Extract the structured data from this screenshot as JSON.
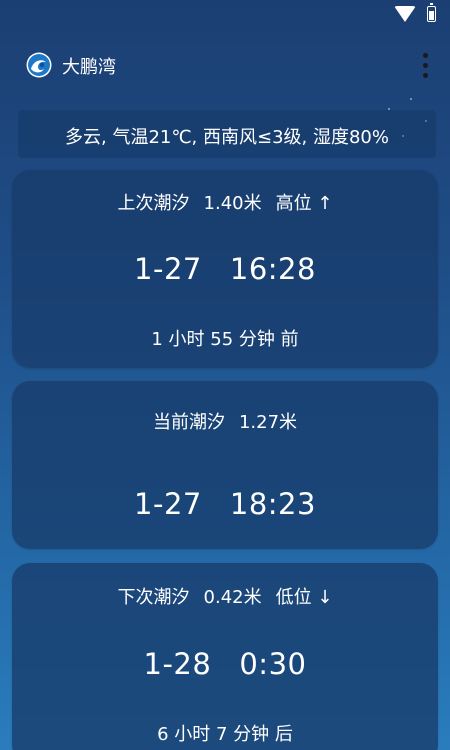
{
  "app": {
    "title": "大鹏湾",
    "logo_icon": "wave-logo-icon",
    "menu_icon": "more-vertical-icon"
  },
  "weather": {
    "text": "多云, 气温21℃, 西南风≤3级, 湿度80%"
  },
  "tides": {
    "previous": {
      "label": "上次潮汐",
      "height": "1.40米",
      "level": "高位 ↑",
      "date": "1-27",
      "time": "16:28",
      "relative": "1 小时 55 分钟 前"
    },
    "current": {
      "label": "当前潮汐",
      "height": "1.27米",
      "date": "1-27",
      "time": "18:23"
    },
    "next": {
      "label": "下次潮汐",
      "height": "0.42米",
      "level": "低位 ↓",
      "date": "1-28",
      "time": "0:30",
      "relative": "6 小时 7 分钟 后"
    }
  },
  "colors": {
    "background_top": "#1b3f73",
    "background_bottom": "#2a7dbd",
    "card": "#183c6c",
    "text": "#ffffff"
  }
}
